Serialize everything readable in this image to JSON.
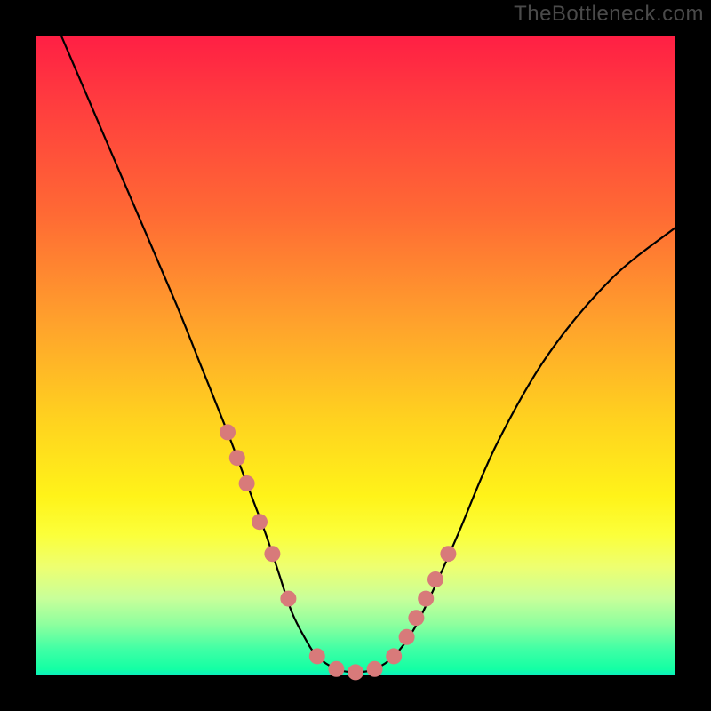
{
  "watermark": "TheBottleneck.com",
  "colors": {
    "background": "#000000",
    "gradient_top": "#ff1f44",
    "gradient_mid": "#fff319",
    "gradient_bottom": "#0aefc0",
    "curve": "#000000",
    "marker": "#d87a7a"
  },
  "chart_data": {
    "type": "line",
    "title": "",
    "xlabel": "",
    "ylabel": "",
    "xlim": [
      0,
      100
    ],
    "ylim": [
      0,
      100
    ],
    "annotations": [
      "TheBottleneck.com"
    ],
    "series": [
      {
        "name": "bottleneck-curve",
        "x": [
          4,
          10,
          16,
          22,
          26,
          30,
          33,
          36,
          38,
          40,
          42,
          44,
          47,
          50,
          53,
          56,
          59,
          62,
          66,
          72,
          80,
          90,
          100
        ],
        "values": [
          100,
          86,
          72,
          58,
          48,
          38,
          30,
          22,
          16,
          10,
          6,
          3,
          1,
          0.5,
          1,
          3,
          7,
          13,
          22,
          36,
          50,
          62,
          70
        ]
      }
    ],
    "markers": {
      "name": "highlight-points",
      "x": [
        30,
        31.5,
        33,
        35,
        37,
        39.5,
        44,
        47,
        50,
        53,
        56,
        58,
        59.5,
        61,
        62.5,
        64.5
      ],
      "values": [
        38,
        34,
        30,
        24,
        19,
        12,
        3,
        1,
        0.5,
        1,
        3,
        6,
        9,
        12,
        15,
        19
      ]
    }
  }
}
